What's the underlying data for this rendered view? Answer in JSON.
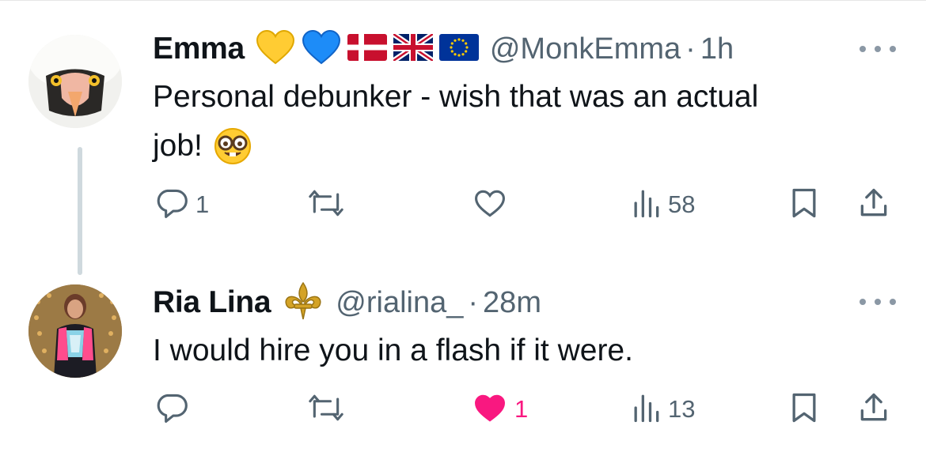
{
  "tweets": [
    {
      "author_name": "Emma",
      "badges": [
        "yellow-heart",
        "blue-heart",
        "denmark-flag",
        "uk-flag",
        "eu-flag"
      ],
      "handle": "@MonkEmma",
      "separator": "·",
      "time": "1h",
      "text_line1": "Personal debunker - wish that was an actual",
      "text_line2": "job!",
      "emoji": "nerd-face",
      "reply_count": "1",
      "retweet_count": "",
      "like_count": "",
      "views_count": "58"
    },
    {
      "author_name": "Ria Lina",
      "badges": [
        "fleur-de-lis"
      ],
      "handle": "@rialina_",
      "separator": "·",
      "time": "28m",
      "text_line1": "I would hire you in a flash if it were.",
      "reply_count": "",
      "retweet_count": "",
      "like_count": "1",
      "liked": true,
      "views_count": "13"
    }
  ],
  "colors": {
    "text": "#0f1419",
    "muted": "#536471",
    "like_active": "#f91880",
    "thread_line": "#cfd9de"
  }
}
